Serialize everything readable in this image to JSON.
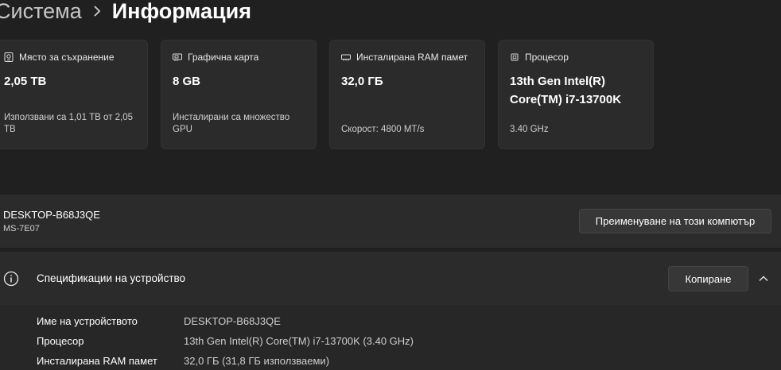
{
  "breadcrumb": {
    "parent": "Система",
    "current": "Информация"
  },
  "cards": [
    {
      "title": "Място за съхранение",
      "icon": "storage-icon",
      "value": "2,05 TB",
      "sub": "Използвани са 1,01 TB от 2,05 TB"
    },
    {
      "title": "Графична карта",
      "icon": "graphics-card-icon",
      "value": "8 GB",
      "sub": "Инсталирани са множество GPU"
    },
    {
      "title": "Инсталирана RAM памет",
      "icon": "memory-icon",
      "value": "32,0 ГБ",
      "sub": "Скорост: 4800 MT/s"
    },
    {
      "title": "Процесор",
      "icon": "processor-icon",
      "value": "13th Gen Intel(R) Core(TM) i7-13700K",
      "sub": "3.40 GHz"
    }
  ],
  "device": {
    "name": "DESKTOP-B68J3QE",
    "model": "MS-7E07",
    "rename_label": "Преименуване на този компютър"
  },
  "specs": {
    "title": "Спецификации на устройство",
    "copy_label": "Копиране",
    "rows": [
      {
        "label": "Име на устройството",
        "value": "DESKTOP-B68J3QE"
      },
      {
        "label": "Процесор",
        "value": "13th Gen Intel(R) Core(TM) i7-13700K (3.40 GHz)"
      },
      {
        "label": "Инсталирана RAM памет",
        "value": "32,0 ГБ (31,8 ГБ използваеми)"
      }
    ]
  }
}
